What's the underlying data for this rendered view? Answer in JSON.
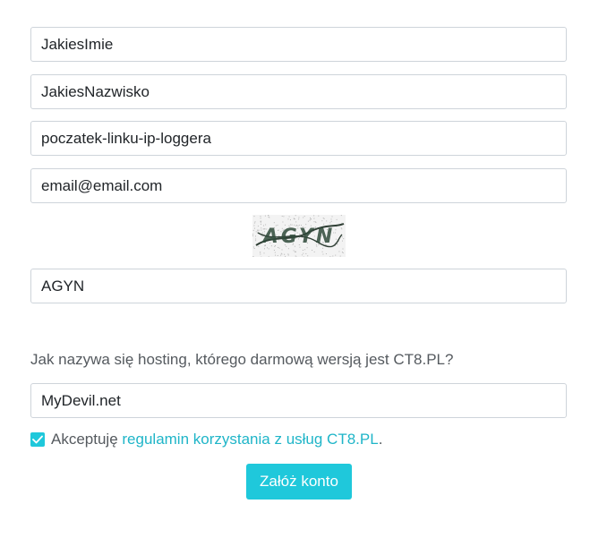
{
  "form": {
    "first_name": "JakiesImie",
    "last_name": "JakiesNazwisko",
    "login": "poczatek-linku-ip-loggera",
    "email": "email@email.com",
    "captcha": {
      "image_text": "AGYN",
      "answer": "AGYN"
    },
    "question": "Jak nazywa się hosting, którego darmową wersją jest CT8.PL?",
    "answer": "MyDevil.net",
    "terms": {
      "checked": true,
      "prefix": "Akceptuję ",
      "link_text": "regulamin korzystania z usług CT8.PL",
      "suffix": "."
    },
    "submit_label": "Załóż konto"
  },
  "colors": {
    "accent": "#1fc8db",
    "link": "#1fb5c8",
    "muted_text": "#555a5f",
    "input_border": "#ced4da"
  },
  "icons": {
    "checkbox": "checkmark-icon"
  }
}
